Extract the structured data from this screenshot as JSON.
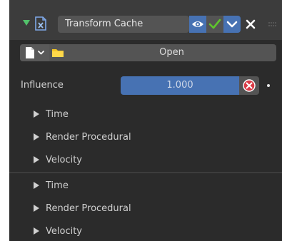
{
  "modifier": {
    "name": "Transform Cache",
    "icons": {
      "expand": "triangle-down-icon",
      "type": "mesh-cache-icon",
      "realtime": "eye-icon",
      "apply": "checkmark-icon",
      "more": "chevron-down-icon",
      "remove": "close-icon",
      "drag": "drag-handle-icon"
    }
  },
  "cache_file": {
    "open_label": "Open",
    "file_icon": "document-icon",
    "folder_icon": "folder-icon"
  },
  "influence": {
    "label": "Influence",
    "value": "1.000",
    "clear_icon": "x-circle-icon",
    "keyframe_icon": "dot-icon"
  },
  "subpanels_a": [
    {
      "label": "Time"
    },
    {
      "label": "Render Procedural"
    },
    {
      "label": "Velocity"
    }
  ],
  "subpanels_b": [
    {
      "label": "Time"
    },
    {
      "label": "Render Procedural"
    },
    {
      "label": "Velocity"
    }
  ],
  "colors": {
    "panel_bg": "#2b2b2b",
    "header_bg": "#3c3c3c",
    "accent_blue": "#4772b3",
    "expand_green": "#52c26b",
    "check_green": "#5fc42d",
    "clear_red": "#d93a45",
    "folder_yellow": "#f5c623"
  }
}
